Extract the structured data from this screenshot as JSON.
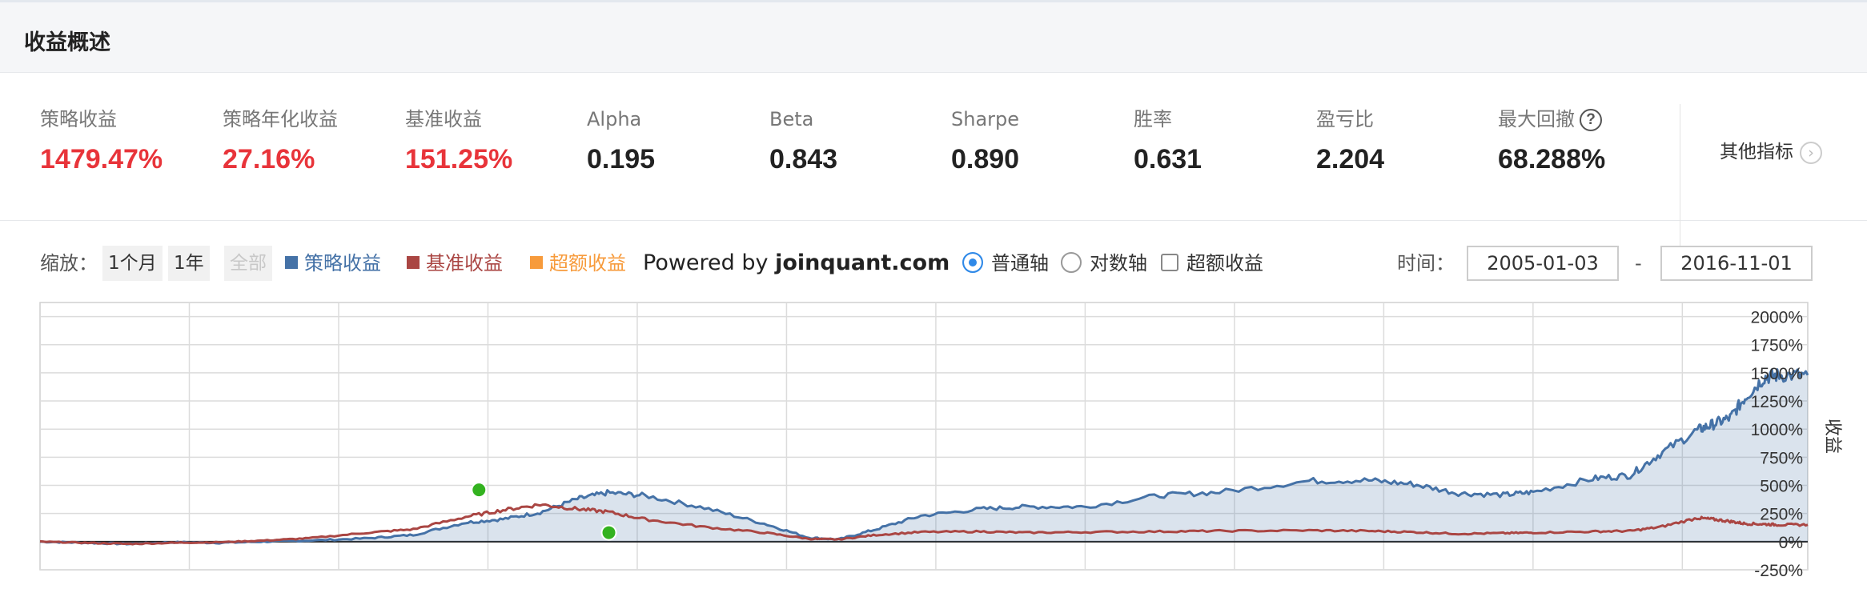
{
  "section_title": "收益概述",
  "metrics": [
    {
      "label": "策略收益",
      "value": "1479.47%",
      "highlight": true
    },
    {
      "label": "策略年化收益",
      "value": "27.16%",
      "highlight": true
    },
    {
      "label": "基准收益",
      "value": "151.25%",
      "highlight": true
    },
    {
      "label": "Alpha",
      "value": "0.195",
      "highlight": false
    },
    {
      "label": "Beta",
      "value": "0.843",
      "highlight": false
    },
    {
      "label": "Sharpe",
      "value": "0.890",
      "highlight": false
    },
    {
      "label": "胜率",
      "value": "0.631",
      "highlight": false
    },
    {
      "label": "盈亏比",
      "value": "2.204",
      "highlight": false
    },
    {
      "label": "最大回撤",
      "value": "68.288%",
      "highlight": false,
      "help_icon": "question-circle-icon"
    }
  ],
  "other_metrics_label": "其他指标",
  "toolbar": {
    "zoom_label": "缩放：",
    "zoom_buttons": [
      "1个月",
      "1年",
      "全部"
    ],
    "legend": [
      {
        "label": "策略收益",
        "color": "#4572a7"
      },
      {
        "label": "基准收益",
        "color": "#aa4643"
      },
      {
        "label": "超额收益",
        "color": "#f79b3c"
      }
    ],
    "powered_prefix": "Powered by",
    "powered_site": "joinquant.com",
    "axis_options": [
      "普通轴",
      "对数轴"
    ],
    "excess_checkbox": "超额收益",
    "time_label": "时间：",
    "date_from": "2005-01-03",
    "date_sep": "-",
    "date_to": "2016-11-01"
  },
  "colors": {
    "strategy": "#4572a7",
    "benchmark": "#aa4643",
    "excess": "#f79b3c",
    "accent_red": "#e8343a",
    "radio_on": "#2f89e8",
    "marker": "#33b21f"
  },
  "chart_data": {
    "type": "area",
    "title": "",
    "xlabel": "",
    "ylabel": "收益",
    "ylim": [
      -250,
      2125
    ],
    "yticks": [
      -250,
      0,
      250,
      500,
      750,
      1000,
      1250,
      1500,
      1750,
      2000
    ],
    "ytick_labels": [
      "-250%",
      "0%",
      "250%",
      "500%",
      "750%",
      "1000%",
      "1250%",
      "1500%",
      "1750%",
      "2000%"
    ],
    "grid": true,
    "x_range": [
      2005.0,
      2016.84
    ],
    "vertical_gridlines": [
      2006.0,
      2007.0,
      2008.0,
      2009.0,
      2010.0,
      2011.0,
      2012.0,
      2013.0,
      2014.0,
      2015.0,
      2016.0
    ],
    "markers": [
      {
        "x": 2007.94,
        "y": 460,
        "series": "策略收益"
      },
      {
        "x": 2008.81,
        "y": 80,
        "series": "策略收益"
      }
    ],
    "series": [
      {
        "name": "策略收益",
        "color": "#4572a7",
        "fill": true,
        "points": [
          [
            2005.0,
            0
          ],
          [
            2005.3,
            -10
          ],
          [
            2005.6,
            -20
          ],
          [
            2005.9,
            -5
          ],
          [
            2006.2,
            -10
          ],
          [
            2006.5,
            0
          ],
          [
            2006.8,
            10
          ],
          [
            2007.2,
            30
          ],
          [
            2007.5,
            60
          ],
          [
            2007.85,
            170
          ],
          [
            2008.1,
            200
          ],
          [
            2008.35,
            260
          ],
          [
            2008.6,
            380
          ],
          [
            2008.8,
            435
          ],
          [
            2009.05,
            410
          ],
          [
            2009.45,
            300
          ],
          [
            2009.85,
            160
          ],
          [
            2010.15,
            35
          ],
          [
            2010.35,
            20
          ],
          [
            2010.6,
            110
          ],
          [
            2010.9,
            230
          ],
          [
            2011.3,
            290
          ],
          [
            2011.6,
            310
          ],
          [
            2012.0,
            310
          ],
          [
            2012.5,
            410
          ],
          [
            2012.9,
            440
          ],
          [
            2013.5,
            540
          ],
          [
            2013.9,
            545
          ],
          [
            2014.2,
            510
          ],
          [
            2014.5,
            430
          ],
          [
            2014.8,
            415
          ],
          [
            2015.0,
            440
          ],
          [
            2015.4,
            560
          ],
          [
            2015.65,
            590
          ],
          [
            2015.85,
            780
          ],
          [
            2016.1,
            990
          ],
          [
            2016.2,
            1040
          ],
          [
            2016.32,
            1100
          ],
          [
            2016.42,
            1280
          ],
          [
            2016.55,
            1460
          ],
          [
            2016.65,
            1480
          ],
          [
            2016.84,
            1480
          ]
        ]
      },
      {
        "name": "基准收益",
        "color": "#aa4643",
        "fill": false,
        "points": [
          [
            2005.0,
            0
          ],
          [
            2005.3,
            -10
          ],
          [
            2005.6,
            -20
          ],
          [
            2005.9,
            -10
          ],
          [
            2006.2,
            -5
          ],
          [
            2006.5,
            10
          ],
          [
            2006.8,
            30
          ],
          [
            2007.2,
            80
          ],
          [
            2007.5,
            110
          ],
          [
            2007.85,
            220
          ],
          [
            2008.1,
            280
          ],
          [
            2008.35,
            330
          ],
          [
            2008.6,
            290
          ],
          [
            2008.8,
            265
          ],
          [
            2009.05,
            200
          ],
          [
            2009.45,
            130
          ],
          [
            2009.85,
            80
          ],
          [
            2010.15,
            25
          ],
          [
            2010.35,
            20
          ],
          [
            2010.6,
            60
          ],
          [
            2010.9,
            85
          ],
          [
            2011.3,
            90
          ],
          [
            2011.6,
            80
          ],
          [
            2012.0,
            85
          ],
          [
            2012.5,
            90
          ],
          [
            2012.9,
            95
          ],
          [
            2013.5,
            100
          ],
          [
            2013.9,
            95
          ],
          [
            2014.2,
            85
          ],
          [
            2014.5,
            70
          ],
          [
            2014.8,
            75
          ],
          [
            2015.0,
            80
          ],
          [
            2015.4,
            90
          ],
          [
            2015.65,
            95
          ],
          [
            2015.85,
            130
          ],
          [
            2016.1,
            210
          ],
          [
            2016.2,
            200
          ],
          [
            2016.32,
            180
          ],
          [
            2016.42,
            160
          ],
          [
            2016.55,
            155
          ],
          [
            2016.65,
            150
          ],
          [
            2016.84,
            150
          ]
        ]
      }
    ]
  }
}
